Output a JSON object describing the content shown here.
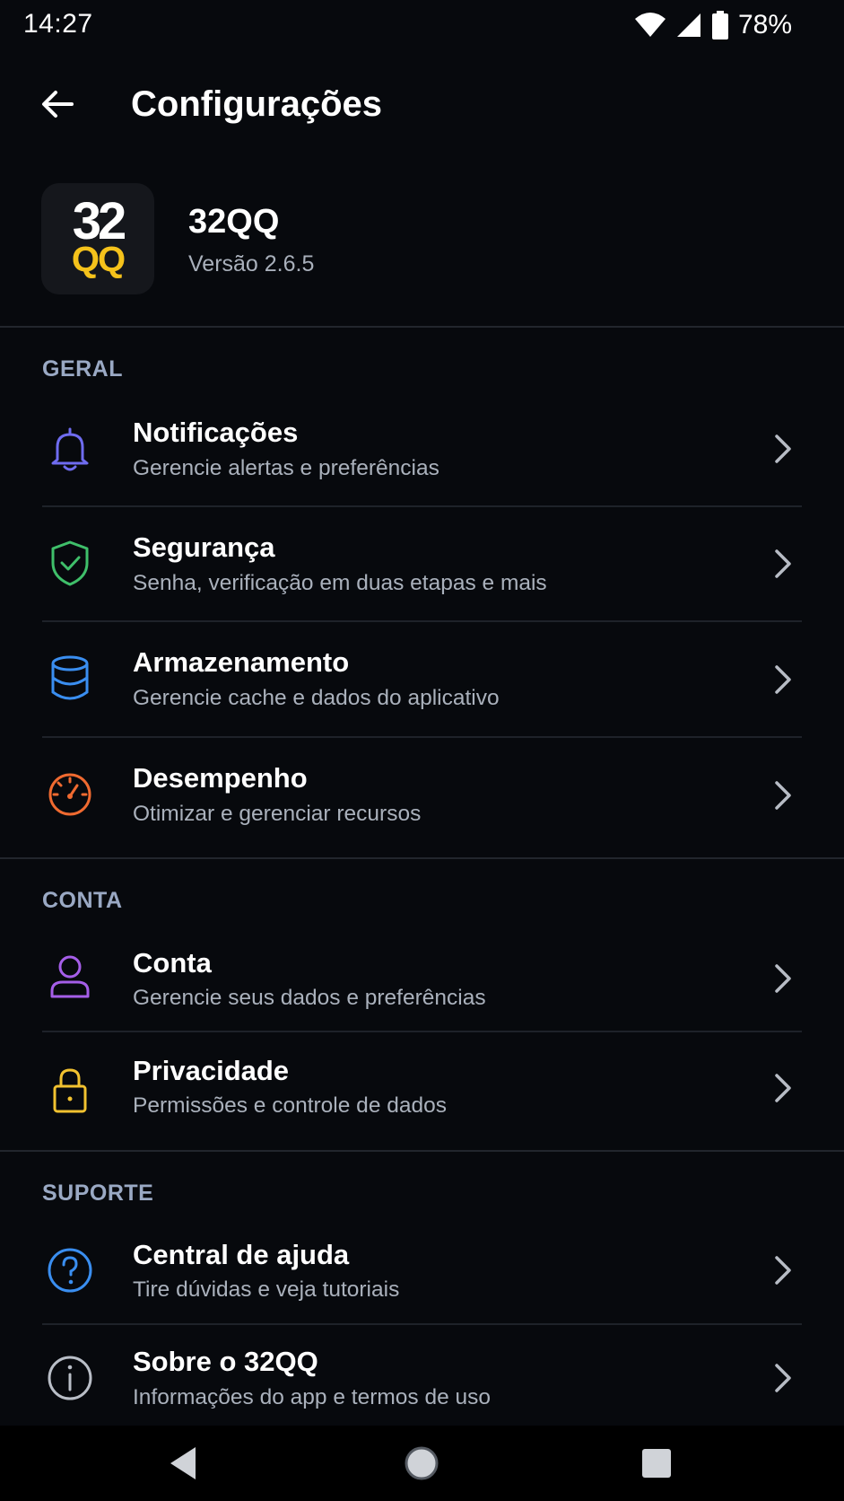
{
  "status_bar": {
    "time": "14:27",
    "battery": "78%",
    "icons": [
      "wifi-icon",
      "cell-signal-icon",
      "battery-icon"
    ]
  },
  "app_bar": {
    "title": "Configurações",
    "back_icon": "back-arrow-icon"
  },
  "app_info": {
    "logo_top": "32",
    "logo_bottom": "QQ",
    "name": "32QQ",
    "version": "Versão 2.6.5"
  },
  "sections": {
    "general": {
      "title": "GERAL",
      "items": [
        {
          "title": "Notificações",
          "subtitle": "Gerencie alertas e preferências",
          "icon": "bell-icon",
          "color": "#6f6cf0"
        },
        {
          "title": "Segurança",
          "subtitle": "Senha, verificação em duas etapas e mais",
          "icon": "shield-check-icon",
          "color": "#3fbf6a"
        },
        {
          "title": "Armazenamento",
          "subtitle": "Gerencie cache e dados do aplicativo",
          "icon": "database-icon",
          "color": "#3a8ef0"
        },
        {
          "title": "Desempenho",
          "subtitle": "Otimizar e gerenciar recursos",
          "icon": "speedometer-icon",
          "color": "#f06a30"
        }
      ]
    },
    "account": {
      "title": "CONTA",
      "items": [
        {
          "title": "Conta",
          "subtitle": "Gerencie seus dados e preferências",
          "icon": "user-icon",
          "color": "#a55ee8"
        },
        {
          "title": "Privacidade",
          "subtitle": "Permissões e controle de dados",
          "icon": "lock-icon",
          "color": "#f2c230"
        }
      ]
    },
    "support": {
      "title": "SUPORTE",
      "items": [
        {
          "title": "Central de ajuda",
          "subtitle": "Tire dúvidas e veja tutoriais",
          "icon": "help-circle-icon",
          "color": "#3a8ef0"
        },
        {
          "title": "Sobre o 32QQ",
          "subtitle": "Informações do app e termos de uso",
          "icon": "info-circle-icon",
          "color": "#b9bec7"
        }
      ]
    }
  },
  "colors": {
    "background": "#07090d",
    "brand_yellow": "#f5c21b",
    "chevron": "#b7bcc5"
  },
  "nav_bar": {
    "buttons": [
      "nav-back-icon",
      "nav-home-icon",
      "nav-recents-icon"
    ]
  }
}
